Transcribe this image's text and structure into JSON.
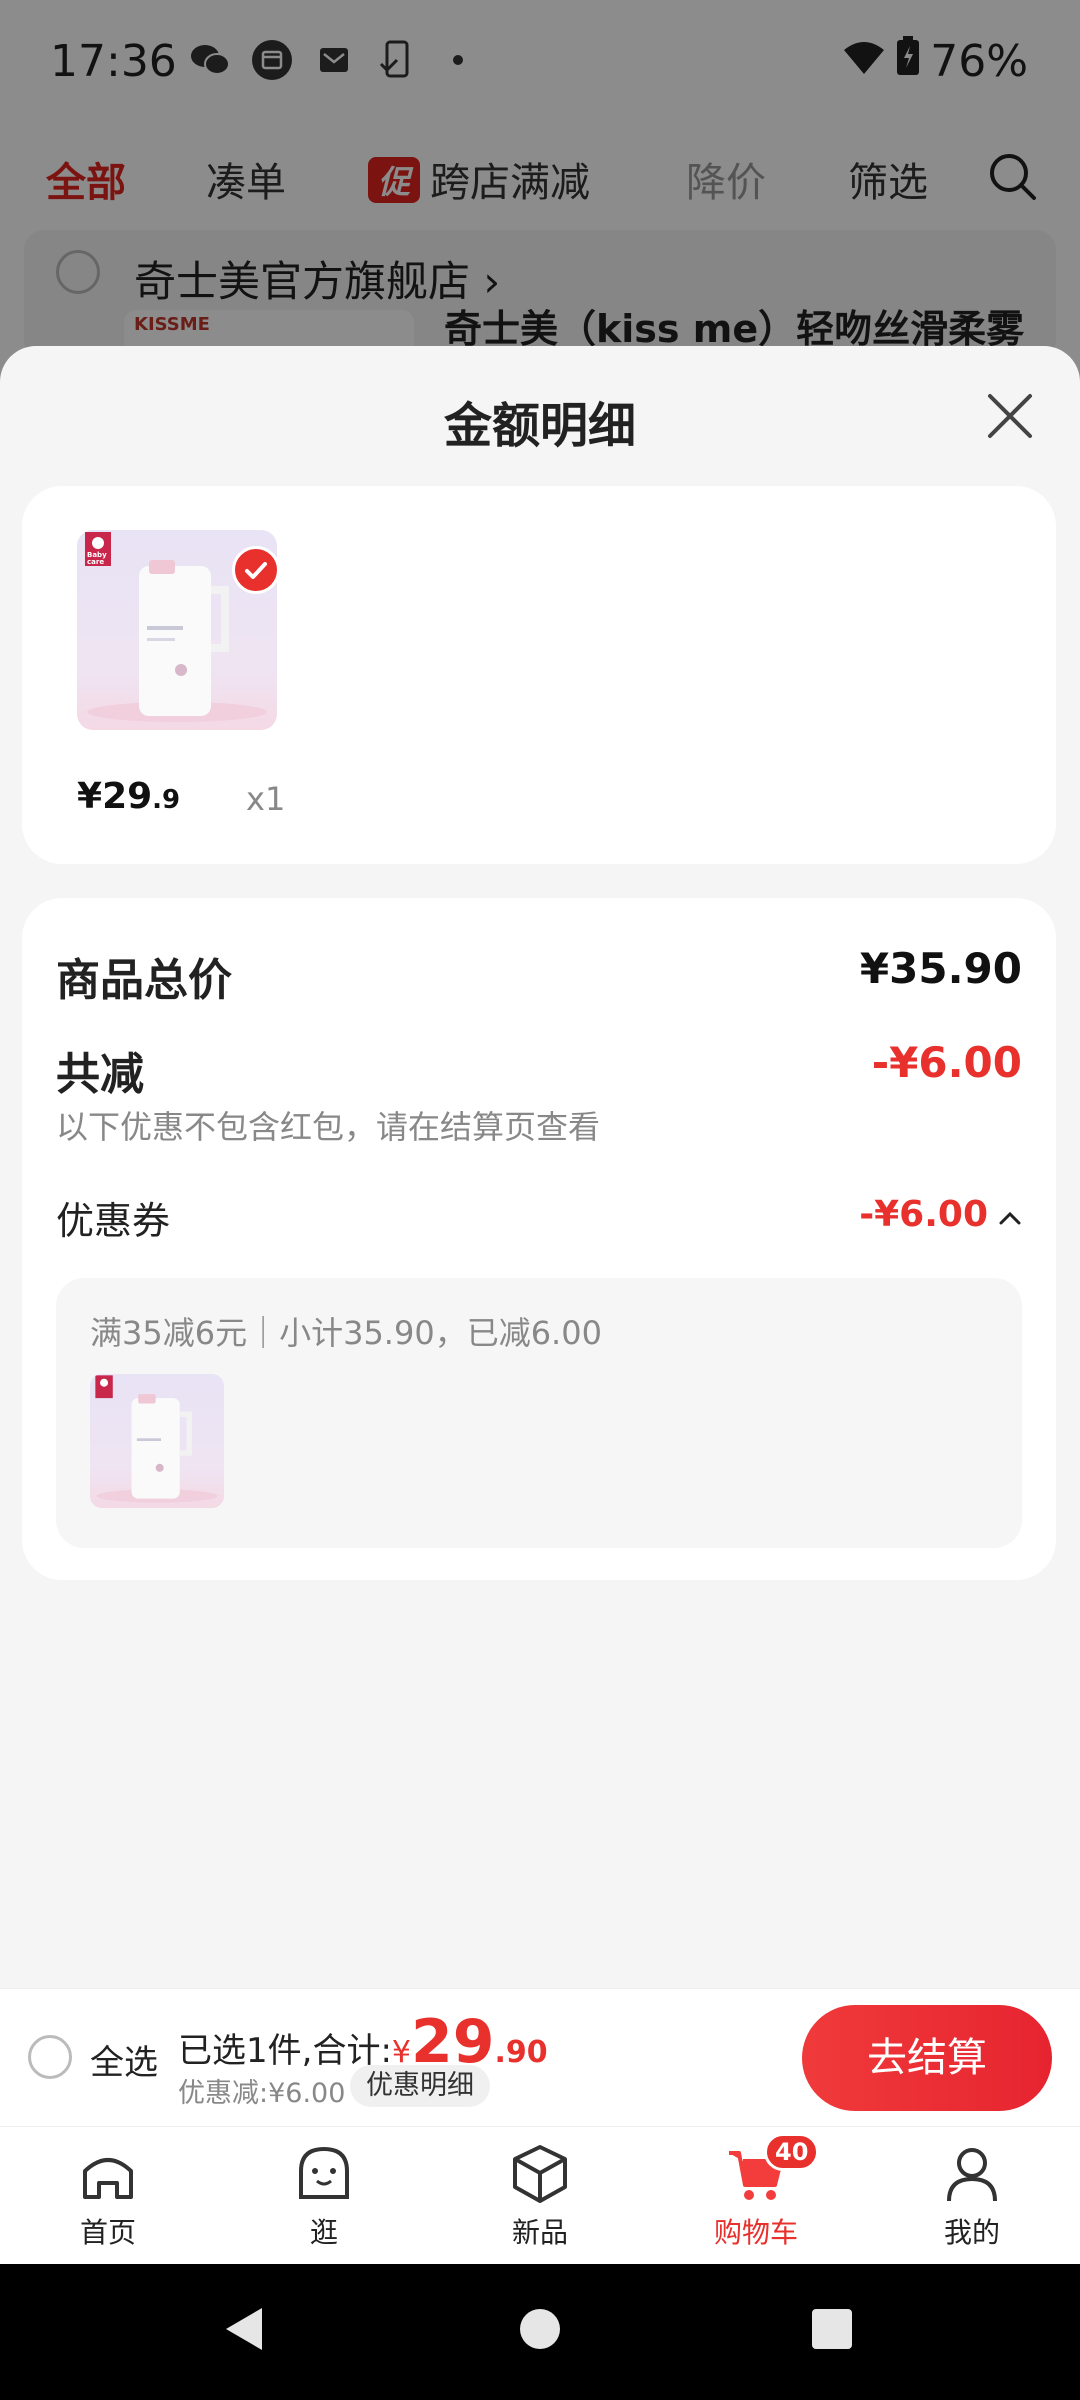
{
  "status_bar": {
    "time": "17:36",
    "battery": "76%",
    "notification_icons": [
      "wechat-icon",
      "calendar-icon",
      "mail-icon",
      "phone-sync-icon",
      "dot-icon"
    ]
  },
  "filter_tabs": {
    "all": "全部",
    "bundle": "凑单",
    "promo_badge": "促",
    "cross_store": "跨店满减",
    "price_drop": "降价",
    "filter": "筛选"
  },
  "background_store": {
    "store_name": "奇士美官方旗舰店",
    "product_title_fragment": "奇士美（kiss me）轻吻丝滑柔雾",
    "thumb_brand": "KISSME"
  },
  "sheet": {
    "title": "金额明细",
    "product": {
      "brand_tag": "Baby care",
      "price_symbol": "¥",
      "price_int": "29",
      "price_dec": ".9",
      "quantity": "x1"
    },
    "detail": {
      "total_label": "商品总价",
      "total_value": "¥35.90",
      "reduce_label": "共减",
      "reduce_value": "-¥6.00",
      "reduce_note": "以下优惠不包含红包，请在结算页查看",
      "coupon_label": "优惠券",
      "coupon_value": "-¥6.00",
      "coupon_desc": "满35减6元｜小计35.90，已减6.00"
    }
  },
  "checkout": {
    "select_all": "全选",
    "summary_prefix": "已选1件,合计:",
    "currency": "¥",
    "amount_int": "29",
    "amount_dec": ".90",
    "discount": "优惠减:¥6.00",
    "detail_button": "优惠明细",
    "checkout_button": "去结算"
  },
  "bottom_nav": {
    "items": [
      {
        "label": "首页",
        "icon": "home-icon"
      },
      {
        "label": "逛",
        "icon": "browse-icon"
      },
      {
        "label": "新品",
        "icon": "box-icon"
      },
      {
        "label": "购物车",
        "icon": "cart-icon",
        "badge": "40",
        "active": true
      },
      {
        "label": "我的",
        "icon": "user-icon"
      }
    ]
  },
  "colors": {
    "accent_red": "#e8302c",
    "sheet_bg": "#f5f5f5"
  }
}
